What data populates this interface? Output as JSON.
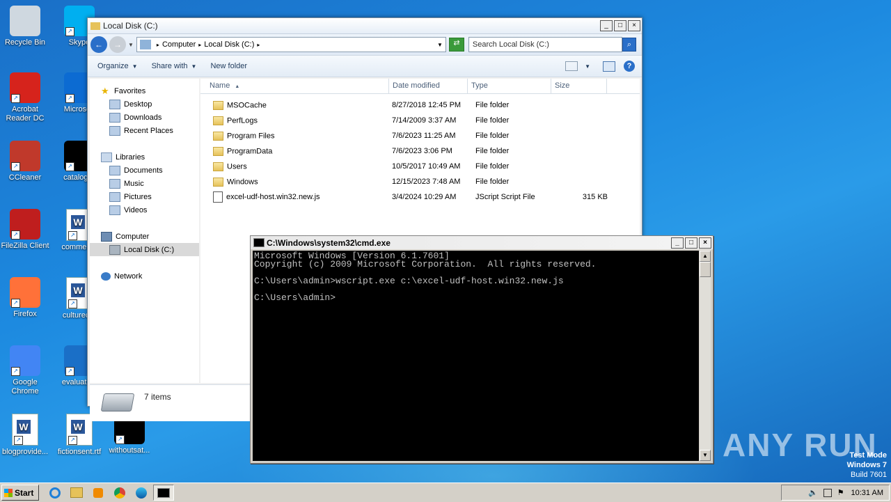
{
  "desktop": {
    "icons": [
      {
        "label": "Recycle Bin",
        "color": "#cfd8e0"
      },
      {
        "label": "Skype",
        "color": "#00aff0"
      },
      {
        "label": "Acrobat Reader DC",
        "color": "#d6231c"
      },
      {
        "label": "Microsoft",
        "color": "#0c6bd2"
      },
      {
        "label": "CCleaner",
        "color": "#c0392b"
      },
      {
        "label": "catalogwi",
        "color": "#000000"
      },
      {
        "label": "FileZilla Client",
        "color": "#bf1e1e"
      },
      {
        "label": "commentb",
        "color": "#ffffff"
      },
      {
        "label": "Firefox",
        "color": "#ff7139"
      },
      {
        "label": "culturecor",
        "color": "#ffffff"
      },
      {
        "label": "Google Chrome",
        "color": "#4285f4"
      },
      {
        "label": "evaluation",
        "color": "#1a6fc7"
      },
      {
        "label": "blogprovide...",
        "color": "#ffffff"
      },
      {
        "label": "fictionsent.rtf",
        "color": "#ffffff"
      },
      {
        "label": "withoutsat...",
        "color": "#000000"
      }
    ],
    "watermark": "ANY RUN",
    "test_mode": {
      "line1": "Test Mode",
      "line2": "Windows 7",
      "line3": "Build 7601"
    }
  },
  "explorer": {
    "title": "Local Disk (C:)",
    "breadcrumb": [
      "Computer",
      "Local Disk (C:)"
    ],
    "search_placeholder": "Search Local Disk (C:)",
    "toolbar": {
      "organize": "Organize",
      "share": "Share with",
      "new_folder": "New folder"
    },
    "nav": {
      "favorites": "Favorites",
      "favorites_items": [
        "Desktop",
        "Downloads",
        "Recent Places"
      ],
      "libraries": "Libraries",
      "libraries_items": [
        "Documents",
        "Music",
        "Pictures",
        "Videos"
      ],
      "computer": "Computer",
      "computer_items": [
        "Local Disk (C:)"
      ],
      "network": "Network"
    },
    "columns": [
      "Name",
      "Date modified",
      "Type",
      "Size"
    ],
    "rows": [
      {
        "name": "MSOCache",
        "date": "8/27/2018 12:45 PM",
        "type": "File folder",
        "size": "",
        "kind": "folder-lock"
      },
      {
        "name": "PerfLogs",
        "date": "7/14/2009 3:37 AM",
        "type": "File folder",
        "size": "",
        "kind": "folder"
      },
      {
        "name": "Program Files",
        "date": "7/6/2023 11:25 AM",
        "type": "File folder",
        "size": "",
        "kind": "folder"
      },
      {
        "name": "ProgramData",
        "date": "7/6/2023 3:06 PM",
        "type": "File folder",
        "size": "",
        "kind": "folder"
      },
      {
        "name": "Users",
        "date": "10/5/2017 10:49 AM",
        "type": "File folder",
        "size": "",
        "kind": "folder"
      },
      {
        "name": "Windows",
        "date": "12/15/2023 7:48 AM",
        "type": "File folder",
        "size": "",
        "kind": "folder"
      },
      {
        "name": "excel-udf-host.win32.new.js",
        "date": "3/4/2024 10:29 AM",
        "type": "JScript Script File",
        "size": "315 KB",
        "kind": "js"
      }
    ],
    "status": "7 items"
  },
  "cmd": {
    "title": "C:\\Windows\\system32\\cmd.exe",
    "lines": [
      "Microsoft Windows [Version 6.1.7601]",
      "Copyright (c) 2009 Microsoft Corporation.  All rights reserved.",
      "",
      "C:\\Users\\admin>wscript.exe c:\\excel-udf-host.win32.new.js",
      "",
      "C:\\Users\\admin>"
    ]
  },
  "taskbar": {
    "start": "Start",
    "clock": "10:31 AM"
  }
}
